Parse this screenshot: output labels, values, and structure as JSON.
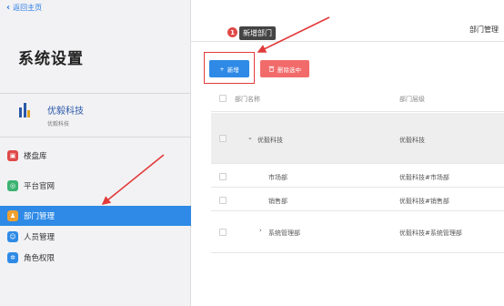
{
  "nav": {
    "back_label": "返回主页"
  },
  "sidebar": {
    "title": "系统设置",
    "org_name": "优毅科技",
    "org_sub": "优毅科技",
    "items": [
      {
        "label": "楼盘库",
        "icon": "building-icon",
        "color": "#e04848"
      },
      {
        "label": "平台官网",
        "icon": "globe-icon",
        "color": "#3cb371"
      },
      {
        "label": "部门管理",
        "icon": "department-icon",
        "color": "#f0a030",
        "active": true
      },
      {
        "label": "人员管理",
        "icon": "people-icon",
        "color": "#2e8ae6"
      },
      {
        "label": "角色权限",
        "icon": "role-icon",
        "color": "#2e8ae6"
      }
    ]
  },
  "header": {
    "page_title": "部门管理"
  },
  "hint": {
    "badge": "1",
    "tooltip": "新增部门"
  },
  "toolbar": {
    "add_label": "新增",
    "add_icon": "+",
    "delete_label": "删除选中",
    "delete_icon": "trash-icon"
  },
  "table": {
    "columns": [
      "部门名称",
      "部门层级"
    ],
    "rows": [
      {
        "name": "优毅科技",
        "level": "优毅科技",
        "expander": "⌄"
      },
      {
        "name": "市场部",
        "level": "优毅科技#市场部",
        "expander": ""
      },
      {
        "name": "销售部",
        "level": "优毅科技#销售部",
        "expander": ""
      },
      {
        "name": "系统管理部",
        "level": "优毅科技#系统管理部",
        "expander": "›"
      }
    ]
  },
  "colors": {
    "accent": "#2e8ae6",
    "danger": "#f26b6b",
    "annotation": "#e23a3a"
  }
}
